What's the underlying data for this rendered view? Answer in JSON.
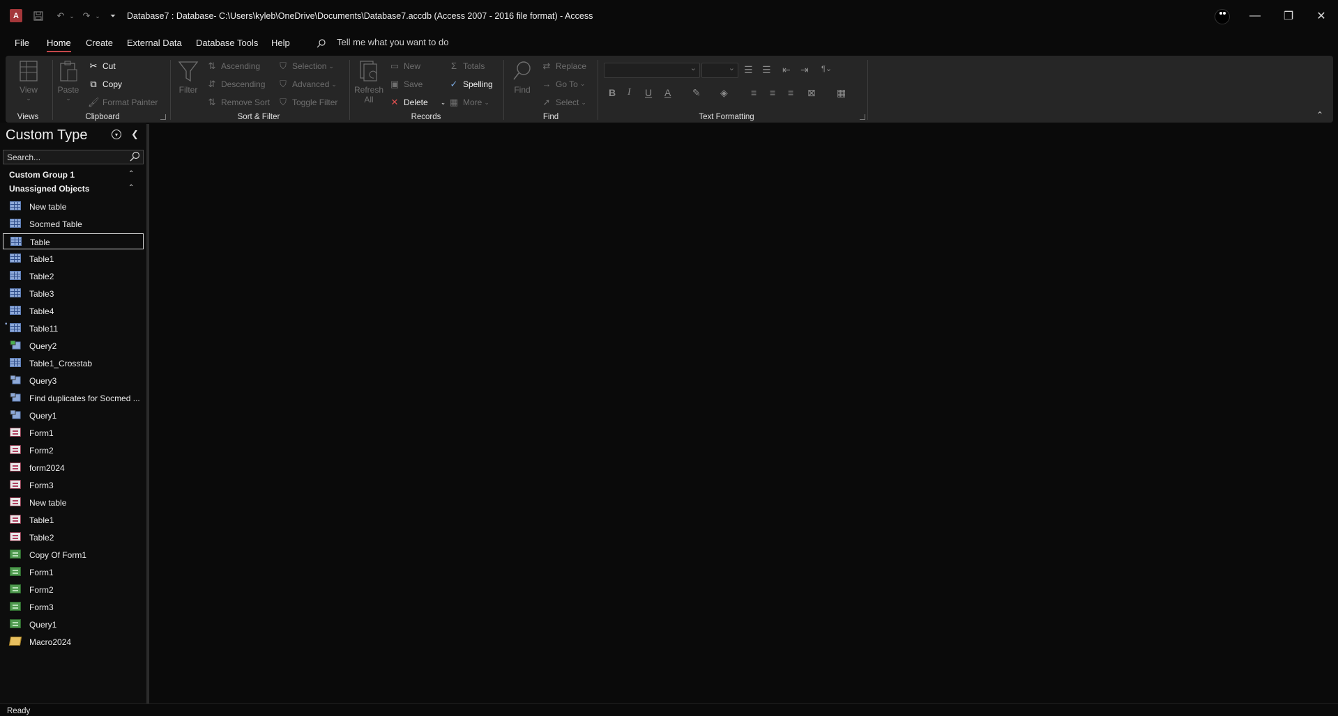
{
  "titlebar": {
    "app_logo": "A",
    "title": "Database7 : Database- C:\\Users\\kyleb\\OneDrive\\Documents\\Database7.accdb (Access 2007 - 2016 file format)  -  Access",
    "quick_access": [
      "save-icon",
      "undo-icon",
      "redo-icon",
      "customize-icon"
    ],
    "minimize": "—",
    "restore": "❐",
    "close": "✕"
  },
  "menu": {
    "tabs": [
      "File",
      "Home",
      "Create",
      "External Data",
      "Database Tools",
      "Help"
    ],
    "active": "Home",
    "tell_me": "Tell me what you want to do"
  },
  "ribbon": {
    "groups": {
      "views": "Views",
      "clipboard": "Clipboard",
      "sort_filter": "Sort & Filter",
      "records": "Records",
      "find": "Find",
      "text_formatting": "Text Formatting"
    },
    "views": {
      "view": "View"
    },
    "clipboard": {
      "paste": "Paste",
      "cut": "Cut",
      "copy": "Copy",
      "format_painter": "Format Painter"
    },
    "sort_filter": {
      "filter": "Filter",
      "ascending": "Ascending",
      "descending": "Descending",
      "remove_sort": "Remove Sort",
      "selection": "Selection",
      "advanced": "Advanced",
      "toggle_filter": "Toggle Filter"
    },
    "records": {
      "refresh": "Refresh",
      "refresh_sub": "All",
      "new": "New",
      "save": "Save",
      "delete": "Delete",
      "totals": "Totals",
      "spelling": "Spelling",
      "more": "More"
    },
    "find": {
      "find": "Find",
      "replace": "Replace",
      "goto": "Go To",
      "select": "Select"
    },
    "text_formatting": {
      "bold": "B",
      "italic": "I",
      "underline": "U",
      "font_color": "A"
    }
  },
  "nav": {
    "title": "Custom Type",
    "search_placeholder": "Search...",
    "groups": [
      "Custom Group 1",
      "Unassigned Objects"
    ],
    "items": [
      {
        "label": "New table",
        "type": "table"
      },
      {
        "label": "Socmed Table",
        "type": "table"
      },
      {
        "label": "Table",
        "type": "table",
        "selected": true
      },
      {
        "label": "Table1",
        "type": "table"
      },
      {
        "label": "Table2",
        "type": "table"
      },
      {
        "label": "Table3",
        "type": "table"
      },
      {
        "label": "Table4",
        "type": "table"
      },
      {
        "label": "Table11",
        "type": "linked-table"
      },
      {
        "label": "Query2",
        "type": "append-query"
      },
      {
        "label": "Table1_Crosstab",
        "type": "crosstab-query"
      },
      {
        "label": "Query3",
        "type": "update-query"
      },
      {
        "label": "Find duplicates for Socmed ...",
        "type": "select-query"
      },
      {
        "label": "Query1",
        "type": "select-query"
      },
      {
        "label": "Form1",
        "type": "form"
      },
      {
        "label": "Form2",
        "type": "form"
      },
      {
        "label": "form2024",
        "type": "form"
      },
      {
        "label": "Form3",
        "type": "form"
      },
      {
        "label": "New table",
        "type": "form"
      },
      {
        "label": "Table1",
        "type": "form"
      },
      {
        "label": "Table2",
        "type": "form"
      },
      {
        "label": "Copy Of Form1",
        "type": "report"
      },
      {
        "label": "Form1",
        "type": "report"
      },
      {
        "label": "Form2",
        "type": "report"
      },
      {
        "label": "Form3",
        "type": "report"
      },
      {
        "label": "Query1",
        "type": "report"
      },
      {
        "label": "Macro2024",
        "type": "macro"
      }
    ]
  },
  "status": {
    "text": "Ready"
  },
  "colors": {
    "accent": "#c4474a",
    "ribbon_bg": "#262626",
    "background": "#0a0a0a"
  }
}
